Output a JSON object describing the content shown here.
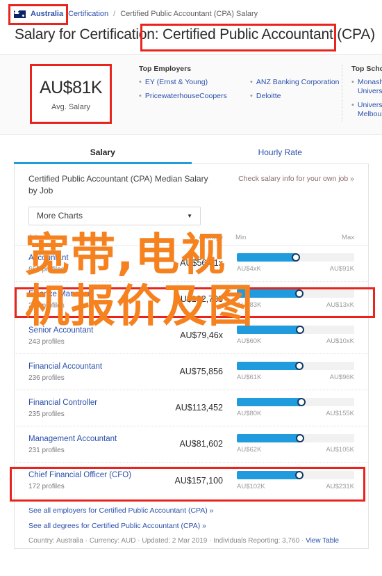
{
  "breadcrumb": {
    "country_flag_icon": "australia-flag-icon",
    "country": "Australia",
    "parent": "Certification",
    "separator": "/",
    "current": "Certified Public Accountant (CPA) Salary"
  },
  "page_title": "Salary for Certification: Certified Public Accountant (CPA)",
  "hero": {
    "avg_salary_value": "AU$81K",
    "avg_salary_label": "Avg. Salary",
    "top_employers": {
      "heading": "Top Employers",
      "col1": [
        "EY (Ernst & Young)",
        "PricewaterhouseCoopers"
      ],
      "col2": [
        "ANZ Banking Corporation",
        "Deloitte"
      ]
    },
    "top_schools": {
      "heading": "Top Schools",
      "items": [
        "Monash University",
        "University of Melbourne"
      ]
    }
  },
  "tabs": [
    {
      "label": "Salary",
      "active": true
    },
    {
      "label": "Hourly Rate",
      "active": false
    }
  ],
  "card": {
    "title": "Certified Public Accountant (CPA) Median Salary by Job",
    "own_job_link": "Check salary info for your own job »",
    "more_charts_label": "More Charts",
    "caret_icon": "chevron-down-icon"
  },
  "footer": {
    "employers_link": "See all employers for Certified Public Accountant (CPA) »",
    "degrees_link": "See all degrees for Certified Public Accountant (CPA) »",
    "meta_prefix": "Country: Australia · Currency: AUD · Updated: 2 Mar 2019 · Individuals Reporting: 3,760 · ",
    "view_table_link": "View Table"
  },
  "annotation": {
    "overlay_text": "宽带,电视\n机报价及图",
    "overlay_color": "#F5821F",
    "box_color": "#E8241C"
  },
  "chart_data": {
    "type": "bar",
    "title": "Certified Public Accountant (CPA) Median Salary by Job",
    "currency": "AUD",
    "columns": [
      "Job",
      "Average",
      "Min",
      "Max"
    ],
    "categories": [
      "Accountant",
      "Finance Manager",
      "Senior Accountant",
      "Financial Accountant",
      "Financial Controller",
      "Management Accountant",
      "Chief Financial Officer (CFO)"
    ],
    "rows": [
      {
        "job": "Accountant",
        "profiles": "665 profiles",
        "average": "AU$56,81x",
        "min": "AU$4xK",
        "max": "AU$91K",
        "min_val": 45000,
        "max_val": 91000,
        "avg_val": 56810
      },
      {
        "job": "Finance Manager",
        "profiles": "289 profiles",
        "average": "AU$102,733",
        "min": "AU$83K",
        "max": "AU$13xK",
        "min_val": 83000,
        "max_val": 135000,
        "avg_val": 102733
      },
      {
        "job": "Senior Accountant",
        "profiles": "243 profiles",
        "average": "AU$79,46x",
        "min": "AU$60K",
        "max": "AU$10xK",
        "min_val": 60000,
        "max_val": 105000,
        "avg_val": 79460
      },
      {
        "job": "Financial Accountant",
        "profiles": "236 profiles",
        "average": "AU$75,856",
        "min": "AU$61K",
        "max": "AU$96K",
        "min_val": 61000,
        "max_val": 96000,
        "avg_val": 75856
      },
      {
        "job": "Financial Controller",
        "profiles": "235 profiles",
        "average": "AU$113,452",
        "min": "AU$80K",
        "max": "AU$155K",
        "min_val": 80000,
        "max_val": 155000,
        "avg_val": 113452
      },
      {
        "job": "Management Accountant",
        "profiles": "231 profiles",
        "average": "AU$81,602",
        "min": "AU$62K",
        "max": "AU$105K",
        "min_val": 62000,
        "max_val": 105000,
        "avg_val": 81602
      },
      {
        "job": "Chief Financial Officer (CFO)",
        "profiles": "172 profiles",
        "average": "AU$157,100",
        "min": "AU$102K",
        "max": "AU$231K",
        "min_val": 102000,
        "max_val": 231000,
        "avg_val": 157100
      }
    ],
    "bar_fill_pct": [
      50,
      53,
      54,
      53,
      55,
      54,
      53
    ],
    "xlabel": "",
    "ylabel": "",
    "legend": "none",
    "grid": false
  }
}
